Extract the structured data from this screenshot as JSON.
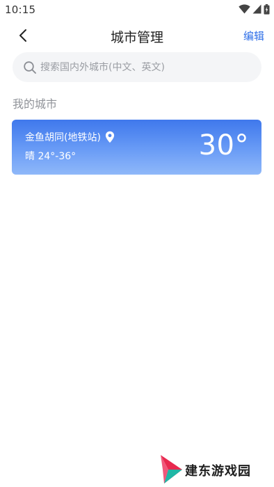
{
  "status_bar": {
    "time": "10:15",
    "icons": [
      "wifi-icon",
      "signal-icon",
      "battery-icon"
    ]
  },
  "header": {
    "back_icon": "chevron-left-icon",
    "title": "城市管理",
    "edit_label": "编辑"
  },
  "search": {
    "placeholder": "搜索国内外城市(中文、英文)",
    "value": ""
  },
  "my_cities": {
    "section_title": "我的城市",
    "items": [
      {
        "name": "金鱼胡同(地铁站)",
        "weather": "晴",
        "temp_range": "24°-36°",
        "current_temp": "30°",
        "is_location": true
      }
    ]
  },
  "watermark": {
    "text": "建东游戏园"
  },
  "colors": {
    "accent": "#2f6fe8",
    "card_gradient_top": "#3f78ec",
    "card_gradient_bottom": "#8fb8f9",
    "search_bg": "#f4f5f7",
    "secondary_text": "#909399"
  }
}
